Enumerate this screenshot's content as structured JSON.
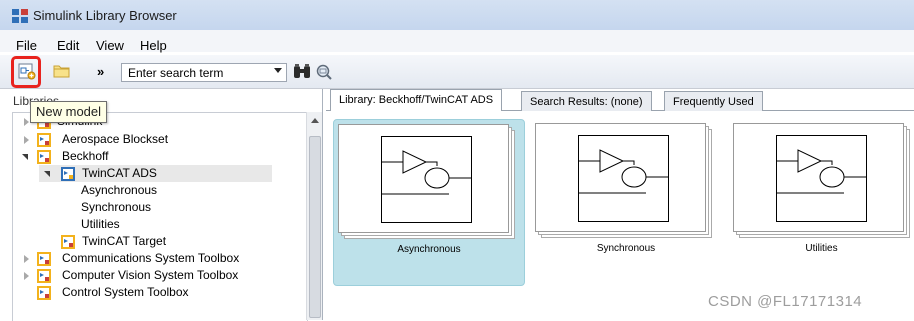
{
  "window": {
    "title": "Simulink Library Browser"
  },
  "menu": [
    "File",
    "Edit",
    "View",
    "Help"
  ],
  "toolbar": {
    "new_model_icon": "new-model-icon",
    "open_icon": "folder-icon",
    "overflow": "»",
    "search_placeholder": "Enter search term",
    "find_icon": "binoculars-icon",
    "options_icon": "search-options-icon"
  },
  "highlight_color": "#e8231e",
  "tooltip": "New model",
  "libraries_header": "Libraries",
  "tree": [
    {
      "label": "Simulink",
      "expander": "closed"
    },
    {
      "label": "Aerospace Blockset",
      "expander": "closed"
    },
    {
      "label": "Beckhoff",
      "expander": "open"
    },
    {
      "label": "TwinCAT ADS",
      "expander": "open",
      "selected": true
    },
    {
      "label": "Asynchronous"
    },
    {
      "label": "Synchronous"
    },
    {
      "label": "Utilities"
    },
    {
      "label": "TwinCAT Target"
    },
    {
      "label": "Communications System Toolbox",
      "expander": "closed"
    },
    {
      "label": "Computer Vision System Toolbox",
      "expander": "closed"
    },
    {
      "label": "Control System Toolbox"
    }
  ],
  "tabs": [
    {
      "label": "Library: Beckhoff/TwinCAT ADS",
      "active": true
    },
    {
      "label": "Search Results: (none)"
    },
    {
      "label": "Frequently Used"
    }
  ],
  "blocks": [
    {
      "label": "Asynchronous",
      "selected": true
    },
    {
      "label": "Synchronous"
    },
    {
      "label": "Utilities"
    }
  ],
  "watermark": "CSDN @FL17171314"
}
